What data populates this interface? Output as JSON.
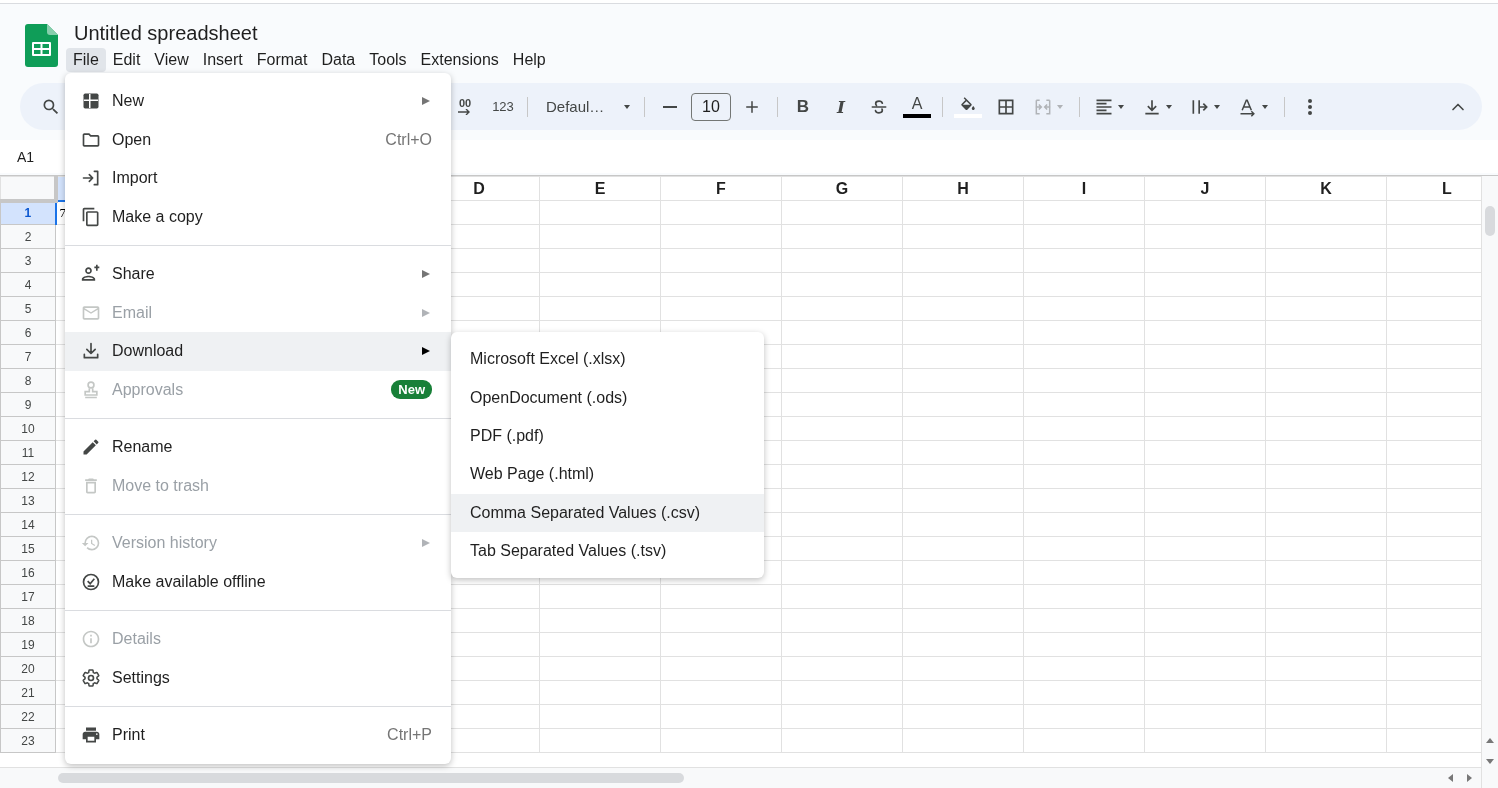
{
  "window": {
    "title": "Untitled spreadsheet"
  },
  "menubar": [
    {
      "label": "File",
      "selected": true
    },
    {
      "label": "Edit",
      "selected": false
    },
    {
      "label": "View",
      "selected": false
    },
    {
      "label": "Insert",
      "selected": false
    },
    {
      "label": "Format",
      "selected": false
    },
    {
      "label": "Data",
      "selected": false
    },
    {
      "label": "Tools",
      "selected": false
    },
    {
      "label": "Extensions",
      "selected": false
    },
    {
      "label": "Help",
      "selected": false
    }
  ],
  "toolbar": [
    {
      "kind": "decimal",
      "label": "00"
    },
    {
      "kind": "format",
      "label": "123"
    },
    {
      "kind": "divider"
    },
    {
      "kind": "font",
      "label": "Defaul…"
    },
    {
      "kind": "divider"
    },
    {
      "kind": "minus"
    },
    {
      "kind": "size",
      "label": "10"
    },
    {
      "kind": "plus"
    },
    {
      "kind": "divider"
    },
    {
      "kind": "bold",
      "label": "B"
    },
    {
      "kind": "italic",
      "label": "I"
    },
    {
      "kind": "strike"
    },
    {
      "kind": "text_color",
      "label": "A",
      "color": "#000000"
    },
    {
      "kind": "divider"
    },
    {
      "kind": "fill_color",
      "color": "#ffffff"
    },
    {
      "kind": "borders"
    },
    {
      "kind": "merge",
      "disabled": true
    },
    {
      "kind": "divider"
    },
    {
      "kind": "halign"
    },
    {
      "kind": "valign"
    },
    {
      "kind": "wrap"
    },
    {
      "kind": "rotate"
    },
    {
      "kind": "divider"
    },
    {
      "kind": "more"
    }
  ],
  "name_box": "A1",
  "columns": [
    "D",
    "E",
    "F",
    "G",
    "H",
    "I",
    "J",
    "K",
    "L"
  ],
  "rows": [
    {
      "label": "1",
      "selected": true,
      "cells": [
        "7"
      ]
    },
    {
      "label": "2",
      "selected": false
    },
    {
      "label": "3",
      "selected": false
    },
    {
      "label": "4",
      "selected": false
    },
    {
      "label": "5",
      "selected": false
    },
    {
      "label": "6",
      "selected": false
    },
    {
      "label": "7",
      "selected": false
    },
    {
      "label": "8",
      "selected": false
    },
    {
      "label": "9",
      "selected": false
    },
    {
      "label": "10",
      "selected": false
    },
    {
      "label": "11",
      "selected": false
    },
    {
      "label": "12",
      "selected": false
    },
    {
      "label": "13",
      "selected": false
    },
    {
      "label": "14",
      "selected": false
    },
    {
      "label": "15",
      "selected": false
    },
    {
      "label": "16",
      "selected": false
    },
    {
      "label": "17",
      "selected": false
    },
    {
      "label": "18",
      "selected": false
    },
    {
      "label": "19",
      "selected": false
    },
    {
      "label": "20",
      "selected": false
    },
    {
      "label": "21",
      "selected": false
    },
    {
      "label": "22",
      "selected": false
    },
    {
      "label": "23",
      "selected": false
    }
  ],
  "file_menu": {
    "items": [
      {
        "kind": "new",
        "label": "New",
        "submenu": true,
        "disabled": false,
        "selected": false
      },
      {
        "kind": "open",
        "label": "Open",
        "shortcut": "Ctrl+O",
        "submenu": false,
        "disabled": false,
        "selected": false
      },
      {
        "kind": "import",
        "label": "Import",
        "submenu": false,
        "disabled": false,
        "selected": false
      },
      {
        "kind": "copy",
        "label": "Make a copy",
        "submenu": false,
        "disabled": false,
        "selected": false
      },
      {
        "kind": "separator"
      },
      {
        "kind": "share",
        "label": "Share",
        "submenu": true,
        "disabled": false,
        "selected": false
      },
      {
        "kind": "email",
        "label": "Email",
        "submenu": true,
        "disabled": true,
        "selected": false
      },
      {
        "kind": "download",
        "label": "Download",
        "submenu": true,
        "disabled": false,
        "selected": true
      },
      {
        "kind": "approvals",
        "label": "Approvals",
        "badge": "New",
        "submenu": false,
        "disabled": true,
        "selected": false
      },
      {
        "kind": "separator"
      },
      {
        "kind": "rename",
        "label": "Rename",
        "submenu": false,
        "disabled": false,
        "selected": false
      },
      {
        "kind": "trash",
        "label": "Move to trash",
        "submenu": false,
        "disabled": true,
        "selected": false
      },
      {
        "kind": "separator"
      },
      {
        "kind": "history",
        "label": "Version history",
        "submenu": true,
        "disabled": true,
        "selected": false
      },
      {
        "kind": "offline",
        "label": "Make available offline",
        "submenu": false,
        "disabled": false,
        "selected": false
      },
      {
        "kind": "separator"
      },
      {
        "kind": "details",
        "label": "Details",
        "submenu": false,
        "disabled": true,
        "selected": false
      },
      {
        "kind": "settings",
        "label": "Settings",
        "submenu": false,
        "disabled": false,
        "selected": false
      },
      {
        "kind": "separator"
      },
      {
        "kind": "print",
        "label": "Print",
        "shortcut": "Ctrl+P",
        "submenu": false,
        "disabled": false,
        "selected": false
      }
    ]
  },
  "download_submenu": {
    "items": [
      {
        "label": "Microsoft Excel (.xlsx)",
        "selected": false
      },
      {
        "label": "OpenDocument (.ods)",
        "selected": false
      },
      {
        "label": "PDF (.pdf)",
        "selected": false
      },
      {
        "label": "Web Page (.html)",
        "selected": false
      },
      {
        "label": "Comma Separated Values (.csv)",
        "selected": true
      },
      {
        "label": "Tab Separated Values (.tsv)",
        "selected": false
      }
    ]
  }
}
